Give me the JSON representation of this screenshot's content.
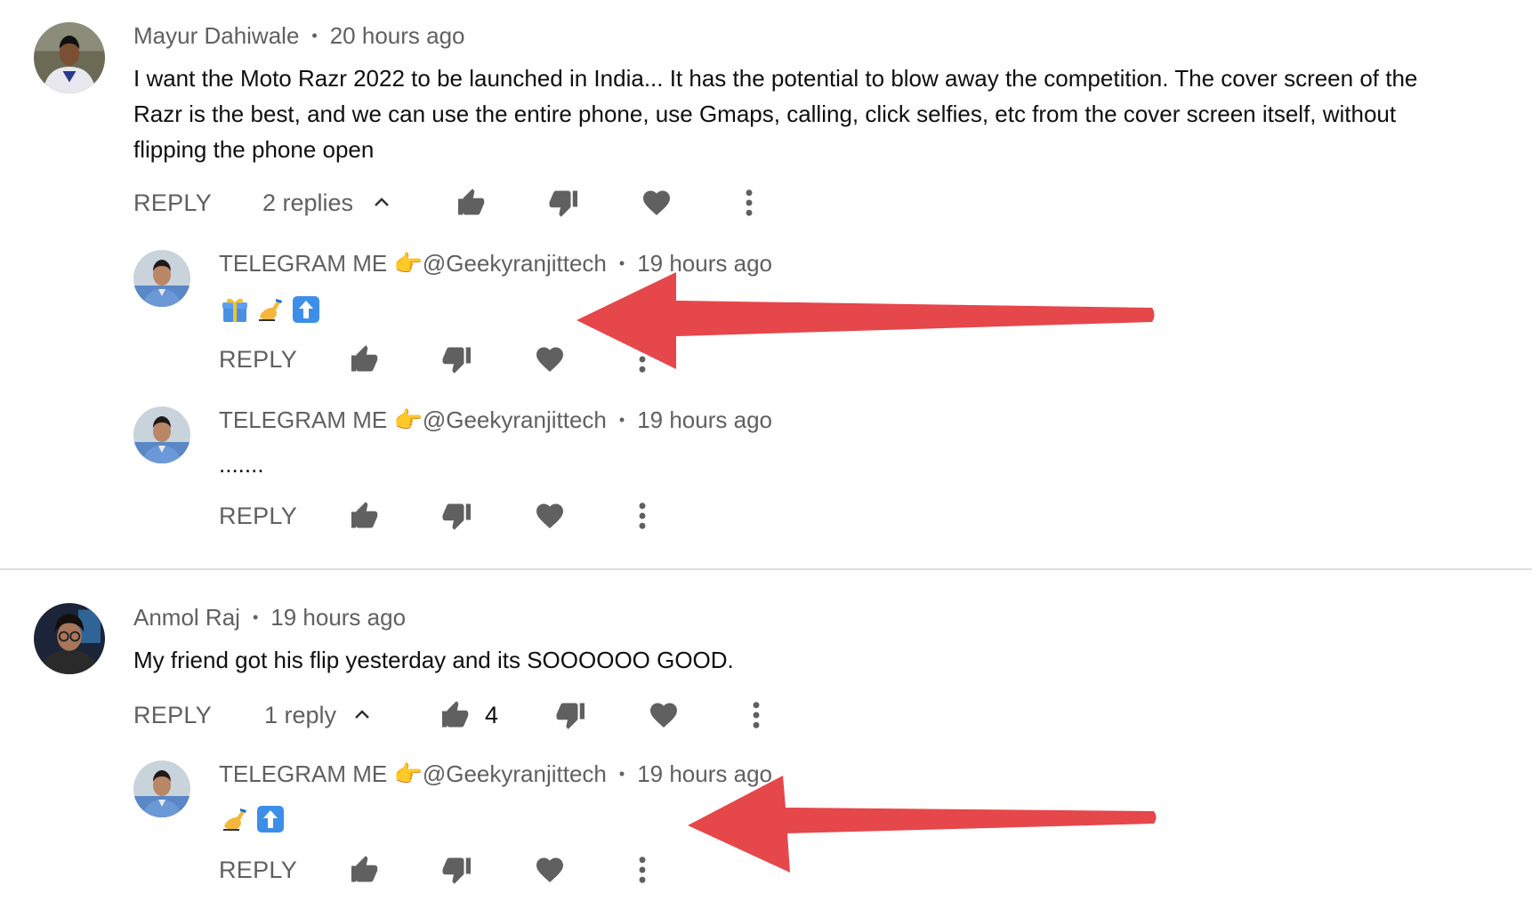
{
  "threads": [
    {
      "author": "Mayur Dahiwale",
      "time": "20 hours ago",
      "text": "I want the Moto Razr 2022 to be launched in India... It has the potential to blow away the competition. The cover screen of the Razr is the best, and we can use the entire phone, use Gmaps, calling, click selfies, etc from the cover screen itself, without flipping the phone open",
      "reply_label": "REPLY",
      "replies_label": "2 replies",
      "replies": [
        {
          "author": "TELEGRAM ME 👉@Geekyranjittech",
          "time": "19 hours ago",
          "emoji_icons": [
            "gift-icon",
            "writing-hand-icon",
            "up-arrow-icon"
          ],
          "reply_label": "REPLY"
        },
        {
          "author": "TELEGRAM ME 👉@Geekyranjittech",
          "time": "19 hours ago",
          "text": ".......",
          "reply_label": "REPLY"
        }
      ]
    },
    {
      "author": "Anmol Raj",
      "time": "19 hours ago",
      "text": "My friend got his flip yesterday and its SOOOOOO GOOD.",
      "reply_label": "REPLY",
      "replies_label": "1 reply",
      "like_count": "4",
      "replies": [
        {
          "author": "TELEGRAM ME 👉@Geekyranjittech",
          "time": "19 hours ago",
          "emoji_icons": [
            "writing-hand-icon",
            "up-arrow-icon"
          ],
          "reply_label": "REPLY"
        }
      ]
    }
  ],
  "colors": {
    "annotation_arrow": "#e5474b",
    "secondary_text": "#606060",
    "icon": "#606060",
    "divider": "#dedede"
  }
}
